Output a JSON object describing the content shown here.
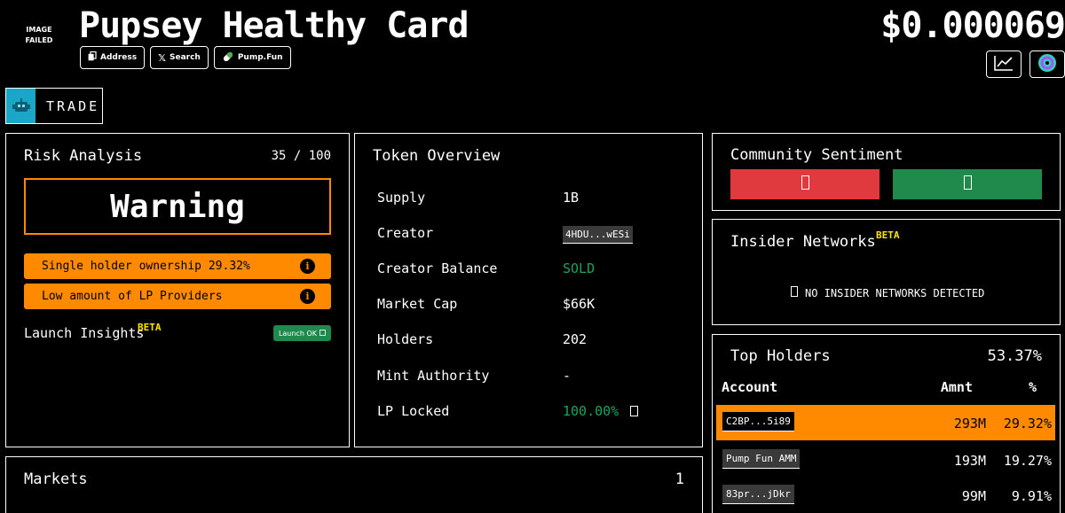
{
  "header": {
    "image_failed": "IMAGE FAILED",
    "title": "Pupsey Healthy Card",
    "price": "$0.000069",
    "pills": [
      {
        "label": "Address",
        "icon": "copy-icon"
      },
      {
        "label": "Search",
        "icon": "x-logo-icon"
      },
      {
        "label": "Pump.Fun",
        "icon": "pill-icon"
      }
    ],
    "chart_icon": "chart-line-icon",
    "app_icon": "app-logo-icon"
  },
  "trade": {
    "label": "TRADE",
    "icon": "robot-icon",
    "icon_color": "#1aa6c7"
  },
  "risk": {
    "title": "Risk Analysis",
    "score": "35 / 100",
    "status": "Warning",
    "items": [
      {
        "label": "Single holder ownership 29.32%"
      },
      {
        "label": "Low amount of LP Providers"
      }
    ],
    "launch_title": "Launch Insights",
    "beta": "BETA",
    "launch_badge": "Launch OK",
    "accent": "#ff8a00"
  },
  "overview": {
    "title": "Token Overview",
    "rows": [
      {
        "label": "Supply",
        "value": "1B"
      },
      {
        "label": "Creator",
        "value": "4HDU...wESi"
      },
      {
        "label": "Creator Balance",
        "value": "SOLD"
      },
      {
        "label": "Market Cap",
        "value": "$66K"
      },
      {
        "label": "Holders",
        "value": "202"
      },
      {
        "label": "Mint Authority",
        "value": "-"
      },
      {
        "label": "LP Locked",
        "value": "100.00%"
      }
    ]
  },
  "sentiment": {
    "title": "Community Sentiment",
    "down_color": "#e0393e",
    "up_color": "#1f8a4c"
  },
  "insider": {
    "title": "Insider Networks",
    "beta": "BETA",
    "message": "NO INSIDER NETWORKS DETECTED"
  },
  "holders": {
    "title": "Top Holders",
    "total": "53.37%",
    "columns": {
      "account": "Account",
      "amount": "Amnt",
      "pct": "%"
    },
    "rows": [
      {
        "account": "C2BP...5i89",
        "amount": "293M",
        "pct": "29.32%"
      },
      {
        "account": "Pump Fun AMM",
        "amount": "193M",
        "pct": "19.27%"
      },
      {
        "account": "83pr...jDkr",
        "amount": "99M",
        "pct": "9.91%"
      }
    ]
  },
  "markets": {
    "title": "Markets",
    "count": "1"
  }
}
